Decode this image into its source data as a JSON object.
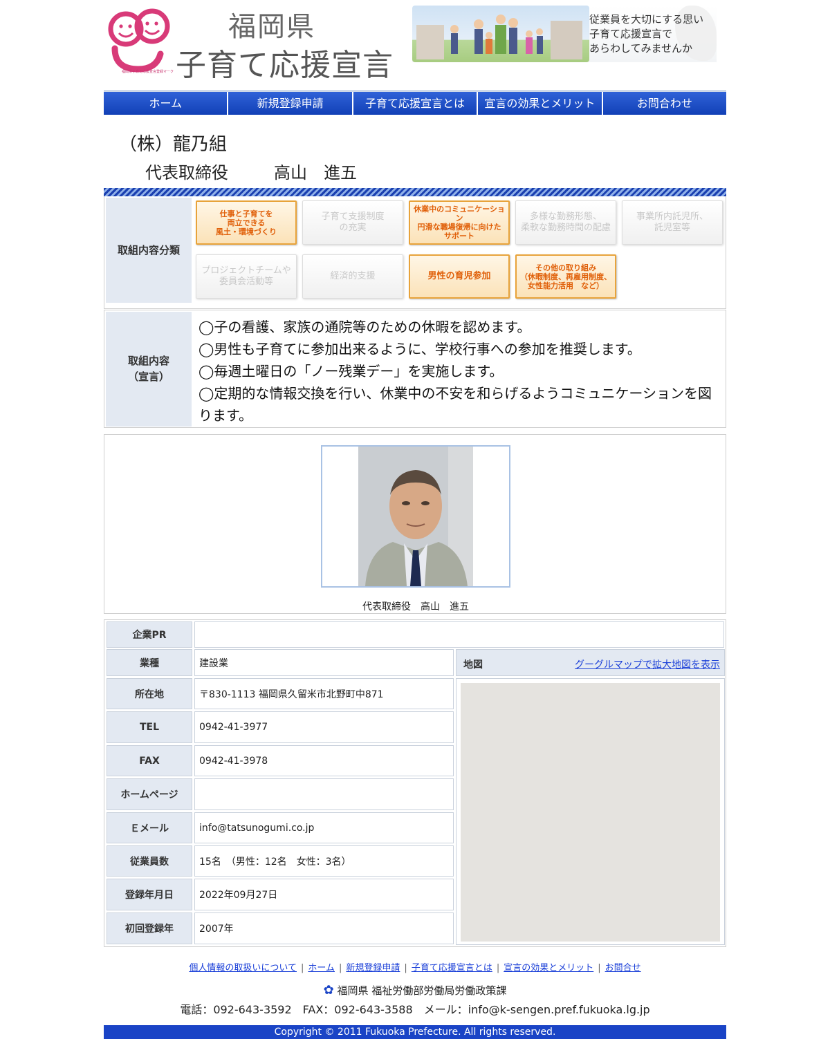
{
  "header": {
    "logo_caption": "福岡県子育て応援宣言登録マーク",
    "title_line1": "福岡県",
    "title_line2": "子育て応援宣言",
    "banner_lines": [
      "従業員を大切にする思い",
      "子育て応援宣言で",
      "あらわしてみませんか"
    ]
  },
  "nav": [
    "ホーム",
    "新規登録申請",
    "子育て応援宣言とは",
    "宣言の効果とメリット",
    "お問合わせ"
  ],
  "company": {
    "name": "（株）龍乃組",
    "rep_title": "代表取締役",
    "rep_name": "高山　進五"
  },
  "categories": {
    "label": "取組内容分類",
    "items": [
      {
        "lines": [
          "仕事と子育てを",
          "両立できる",
          "風土・環境づくり"
        ],
        "active": true
      },
      {
        "lines": [
          "子育て支援制度",
          "の充実"
        ],
        "active": false
      },
      {
        "lines": [
          "休業中のコミュニケーション",
          "円滑な職場復帰に向けた",
          "サポート"
        ],
        "active": true
      },
      {
        "lines": [
          "多様な勤務形態、",
          "柔軟な勤務時間の配慮"
        ],
        "active": false
      },
      {
        "lines": [
          "事業所内託児所、",
          "託児室等"
        ],
        "active": false
      },
      {
        "lines": [
          "プロジェクトチームや",
          "委員会活動等"
        ],
        "active": false
      },
      {
        "lines": [
          "経済的支援"
        ],
        "active": false
      },
      {
        "lines": [
          "男性の育児参加"
        ],
        "active": true
      },
      {
        "lines": [
          "その他の取り組み",
          "（休暇制度、再雇用制度、",
          "女性能力活用　など）"
        ],
        "active": true
      }
    ]
  },
  "declaration": {
    "label_line1": "取組内容",
    "label_line2": "（宣言）",
    "lines": [
      "◯子の看護、家族の通院等のための休暇を認めます。",
      "◯男性も子育てに参加出来るように、学校行事への参加を推奨します。",
      "◯毎週土曜日の「ノー残業デー」を実施します。",
      "◯定期的な情報交換を行い、休業中の不安を和らげるようコミュニケーションを図ります。"
    ]
  },
  "photo": {
    "caption": "代表取締役　高山　進五"
  },
  "info": {
    "rows": [
      {
        "label": "企業PR",
        "value": ""
      },
      {
        "label": "業種",
        "value": "建設業"
      },
      {
        "label": "所在地",
        "value": "〒830-1113 福岡県久留米市北野町中871"
      },
      {
        "label": "TEL",
        "value": "0942-41-3977"
      },
      {
        "label": "FAX",
        "value": "0942-41-3978"
      },
      {
        "label": "ホームページ",
        "value": ""
      },
      {
        "label": "Ｅメール",
        "value": "info@tatsunogumi.co.jp"
      },
      {
        "label": "従業員数",
        "value": "15名　（男性：12名　女性：3名）"
      },
      {
        "label": "登録年月日",
        "value": "2022年09月27日"
      },
      {
        "label": "初回登録年",
        "value": "2007年"
      }
    ],
    "map_label": "地図",
    "map_link": "グーグルマップで拡大地図を表示"
  },
  "footer": {
    "links": [
      "個人情報の取扱いについて",
      "ホーム",
      "新規登録申請",
      "子育て応援宣言とは",
      "宣言の効果とメリット",
      "お問合せ"
    ],
    "department": "福岡県 福祉労働部労働局労働政策課",
    "contact": "電話：092-643-3592　FAX：092-643-3588　メール：info@k-sengen.pref.fukuoka.lg.jp",
    "copyright": "Copyright © 2011 Fukuoka Prefecture. All rights reserved."
  }
}
